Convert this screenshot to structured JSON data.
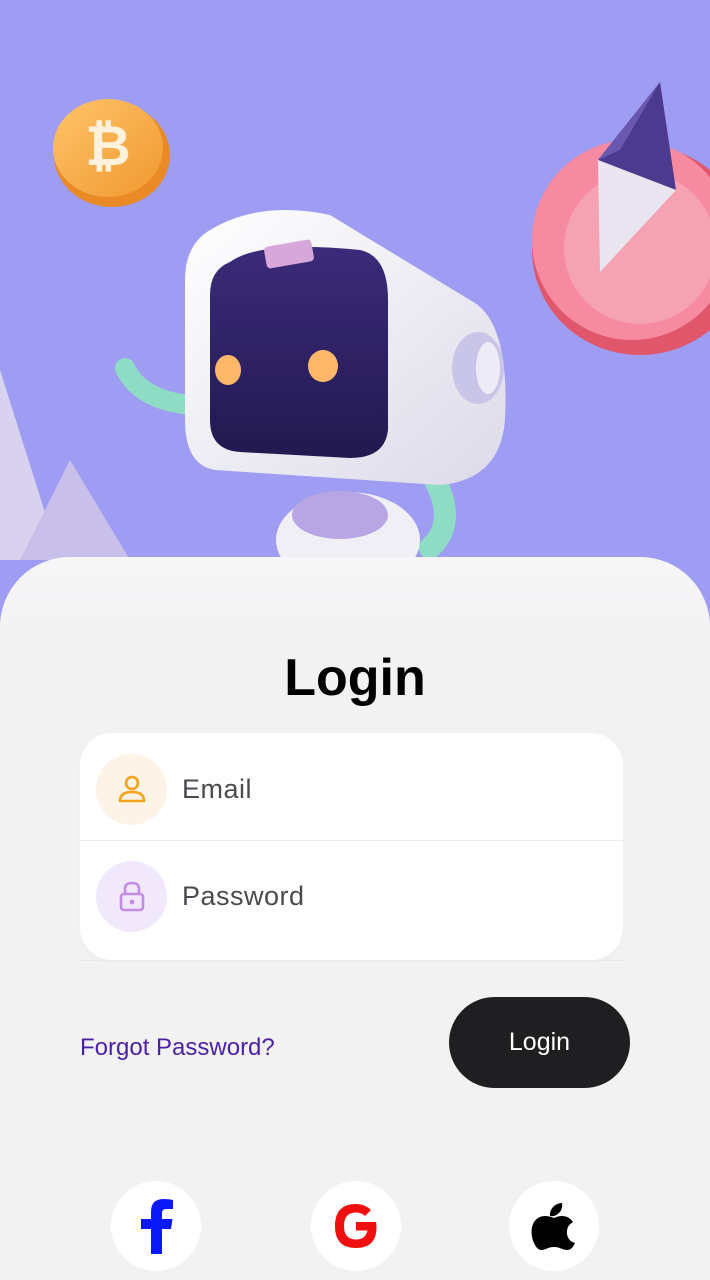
{
  "hero": {
    "illustration": "robot-with-crypto-coins",
    "background_color": "#9e9cf3"
  },
  "login": {
    "title": "Login",
    "email_placeholder": "Email",
    "password_placeholder": "Password",
    "forgot_password": "Forgot Password?",
    "login_button": "Login"
  },
  "icons": {
    "email": "user-icon",
    "password": "lock-icon"
  },
  "social": [
    {
      "name": "facebook-icon",
      "color": "#0a19f5"
    },
    {
      "name": "google-icon",
      "color": "#ef0f0f"
    },
    {
      "name": "apple-icon",
      "color": "#000000"
    }
  ],
  "colors": {
    "accent_link": "#4b1fa8",
    "button_bg": "#1f1f22"
  }
}
